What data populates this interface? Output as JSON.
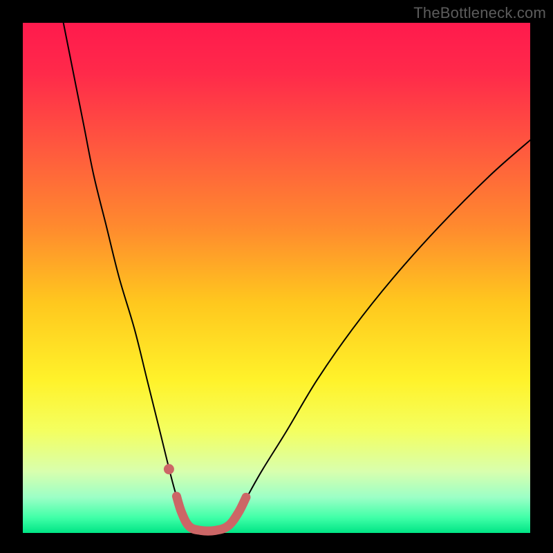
{
  "watermark": "TheBottleneck.com",
  "chart_data": {
    "type": "line",
    "title": "",
    "xlabel": "",
    "ylabel": "",
    "xlim": [
      0,
      100
    ],
    "ylim": [
      0,
      100
    ],
    "background_gradient": {
      "stops": [
        {
          "offset": 0.0,
          "color": "#ff1a4d"
        },
        {
          "offset": 0.1,
          "color": "#ff2a4a"
        },
        {
          "offset": 0.25,
          "color": "#ff5a3e"
        },
        {
          "offset": 0.4,
          "color": "#ff8a2e"
        },
        {
          "offset": 0.55,
          "color": "#ffc81e"
        },
        {
          "offset": 0.7,
          "color": "#fff22a"
        },
        {
          "offset": 0.8,
          "color": "#f4ff60"
        },
        {
          "offset": 0.88,
          "color": "#d8ffae"
        },
        {
          "offset": 0.93,
          "color": "#9cffc6"
        },
        {
          "offset": 0.97,
          "color": "#40ffa8"
        },
        {
          "offset": 1.0,
          "color": "#00e585"
        }
      ]
    },
    "series": [
      {
        "name": "bottleneck-curve",
        "type": "line",
        "stroke": "#000000",
        "stroke_width": 2,
        "points": [
          {
            "x": 8.0,
            "y": 100.0
          },
          {
            "x": 10.0,
            "y": 90.0
          },
          {
            "x": 12.0,
            "y": 80.0
          },
          {
            "x": 14.0,
            "y": 70.0
          },
          {
            "x": 16.5,
            "y": 60.0
          },
          {
            "x": 19.0,
            "y": 50.0
          },
          {
            "x": 22.0,
            "y": 40.0
          },
          {
            "x": 24.5,
            "y": 30.0
          },
          {
            "x": 27.0,
            "y": 20.0
          },
          {
            "x": 29.5,
            "y": 10.0
          },
          {
            "x": 31.0,
            "y": 5.0
          },
          {
            "x": 32.5,
            "y": 1.5
          },
          {
            "x": 35.0,
            "y": 0.5
          },
          {
            "x": 38.0,
            "y": 0.5
          },
          {
            "x": 40.5,
            "y": 1.5
          },
          {
            "x": 43.0,
            "y": 5.0
          },
          {
            "x": 47.0,
            "y": 12.0
          },
          {
            "x": 52.0,
            "y": 20.0
          },
          {
            "x": 58.0,
            "y": 30.0
          },
          {
            "x": 65.0,
            "y": 40.0
          },
          {
            "x": 73.0,
            "y": 50.0
          },
          {
            "x": 82.0,
            "y": 60.0
          },
          {
            "x": 92.0,
            "y": 70.0
          },
          {
            "x": 100.0,
            "y": 77.0
          }
        ]
      },
      {
        "name": "optimal-bottom-segment",
        "type": "line",
        "stroke": "#cc6666",
        "stroke_width": 13,
        "points": [
          {
            "x": 30.3,
            "y": 7.2
          },
          {
            "x": 31.3,
            "y": 4.0
          },
          {
            "x": 32.8,
            "y": 1.3
          },
          {
            "x": 35.0,
            "y": 0.5
          },
          {
            "x": 38.0,
            "y": 0.5
          },
          {
            "x": 40.5,
            "y": 1.4
          },
          {
            "x": 42.5,
            "y": 4.0
          },
          {
            "x": 44.0,
            "y": 7.0
          }
        ]
      },
      {
        "name": "dot-marker",
        "type": "scatter",
        "stroke": "#cc6666",
        "points": [
          {
            "x": 28.8,
            "y": 12.5
          }
        ]
      }
    ]
  }
}
